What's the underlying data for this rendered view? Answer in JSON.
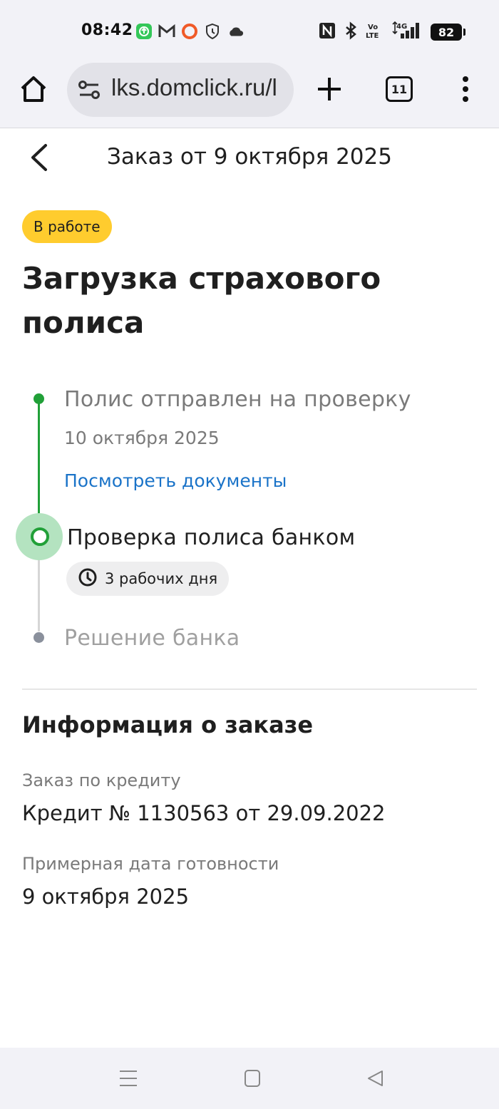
{
  "status_bar": {
    "time": "08:42",
    "battery": "82",
    "left_icons": [
      "sync-icon",
      "gmail-icon",
      "record-icon",
      "vpn-shield-icon",
      "cloud-icon"
    ],
    "right_icons": [
      "nfc-icon",
      "bluetooth-icon",
      "volte-icon",
      "signal-4g-icon",
      "battery-icon"
    ]
  },
  "browser": {
    "url": "lks.domclick.ru/l",
    "tab_count": "11"
  },
  "header": {
    "title": "Заказ от 9 октября 2025"
  },
  "order": {
    "status_badge": "В работе",
    "title": "Загрузка страхового полиса"
  },
  "timeline": {
    "steps": [
      {
        "title": "Полис отправлен на проверку",
        "date": "10 октября 2025",
        "link": "Посмотреть документы",
        "state": "done"
      },
      {
        "title": "Проверка полиса банком",
        "duration": "3 рабочих дня",
        "state": "current"
      },
      {
        "title": "Решение банка",
        "state": "pending"
      }
    ]
  },
  "info": {
    "heading": "Информация о заказе",
    "credit_label": "Заказ по кредиту",
    "credit_value": "Кредит № 1130563 от 29.09.2022",
    "date_label": "Примерная дата готовности",
    "date_value": "9 октября 2025"
  },
  "colors": {
    "accent_green": "#21a038",
    "badge_yellow": "#ffcc2e",
    "link_blue": "#1a73c8"
  }
}
